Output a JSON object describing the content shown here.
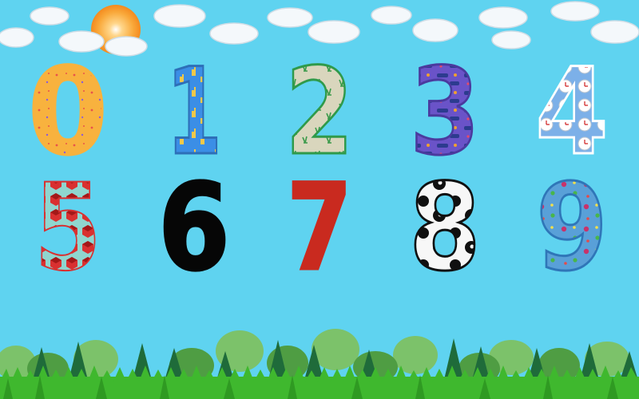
{
  "game": {
    "numbers": [
      {
        "value": "0",
        "fill_color": "#f8b23e",
        "outline_color": "#f8b23e",
        "pattern": "speckles"
      },
      {
        "value": "1",
        "fill_color": "#3b8ee6",
        "outline_color": "#2d6fb8",
        "pattern": "hand-signs"
      },
      {
        "value": "2",
        "fill_color": "#d9d6bd",
        "outline_color": "#2f9a4a",
        "pattern": "peace-hands"
      },
      {
        "value": "3",
        "fill_color": "#6a53c8",
        "outline_color": "#4b3a9e",
        "pattern": "three-words"
      },
      {
        "value": "4",
        "fill_color": "#7cb0e8",
        "outline_color": "#ffffff",
        "pattern": "clocks"
      },
      {
        "value": "5",
        "fill_color": "#8fd6cf",
        "outline_color": "#d93030",
        "pattern": "red-cubes"
      },
      {
        "value": "6",
        "fill_color": "#060606",
        "outline_color": "#060606",
        "pattern": "solid"
      },
      {
        "value": "7",
        "fill_color": "#c92a1f",
        "outline_color": "#c92a1f",
        "pattern": "solid"
      },
      {
        "value": "8",
        "fill_color": "#f7f7f7",
        "outline_color": "#101010",
        "pattern": "panda"
      },
      {
        "value": "9",
        "fill_color": "#59a0d8",
        "outline_color": "#2f76b8",
        "pattern": "polka-dots"
      }
    ]
  },
  "scene": {
    "sky_color": "#5fd3f0",
    "sun_color": "#f9a93b",
    "grass_color": "#3fb82e",
    "tree_colors": [
      "#1f6b3a",
      "#4f9d43",
      "#2e7d4a",
      "#7cc26a"
    ],
    "icons": [
      "sun-icon",
      "cloud-icon",
      "tree-icon",
      "grass-icon"
    ]
  }
}
